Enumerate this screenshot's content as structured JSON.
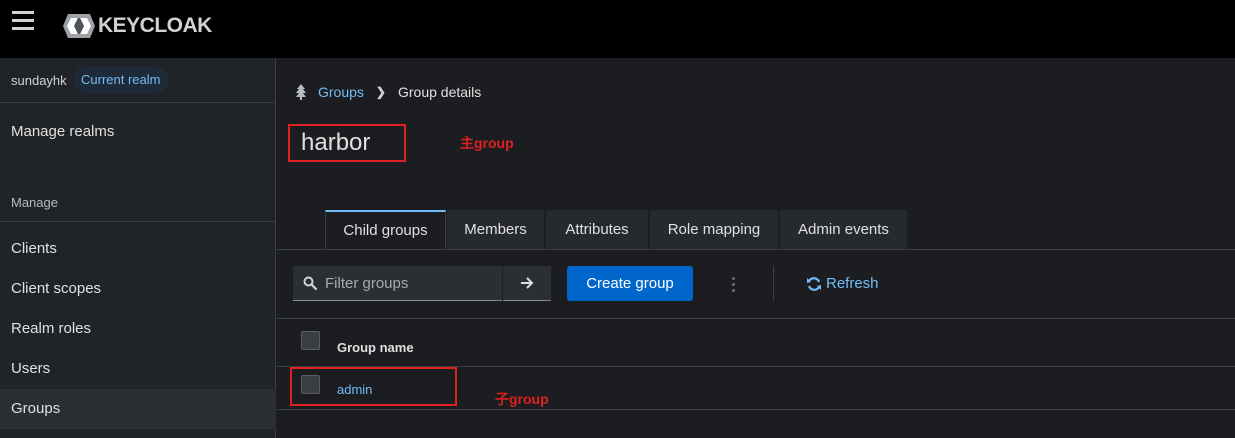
{
  "masthead": {
    "brand": "KEYCLOAK"
  },
  "sidebar": {
    "realm_name": "sundayhk",
    "realm_badge": "Current realm",
    "manage_realms": "Manage realms",
    "section_label": "Manage",
    "items": [
      {
        "label": "Clients"
      },
      {
        "label": "Client scopes"
      },
      {
        "label": "Realm roles"
      },
      {
        "label": "Users"
      },
      {
        "label": "Groups"
      }
    ],
    "active_item": "Groups"
  },
  "breadcrumb": {
    "link": "Groups",
    "current": "Group details"
  },
  "page": {
    "title": "harbor"
  },
  "annotations": {
    "title_note": "主group",
    "row_note": "子group",
    "color": "#e02020"
  },
  "tabs": [
    {
      "label": "Child groups",
      "active": true
    },
    {
      "label": "Members",
      "active": false
    },
    {
      "label": "Attributes",
      "active": false
    },
    {
      "label": "Role mapping",
      "active": false
    },
    {
      "label": "Admin events",
      "active": false
    }
  ],
  "toolbar": {
    "search_placeholder": "Filter groups",
    "search_value": "",
    "create_label": "Create group",
    "refresh_label": "Refresh"
  },
  "table": {
    "columns": [
      "Group name"
    ],
    "rows": [
      {
        "name": "admin"
      }
    ]
  },
  "colors": {
    "accent": "#0066cc",
    "link": "#73bcf7",
    "background": "#1b1d21",
    "masthead": "#000000"
  }
}
